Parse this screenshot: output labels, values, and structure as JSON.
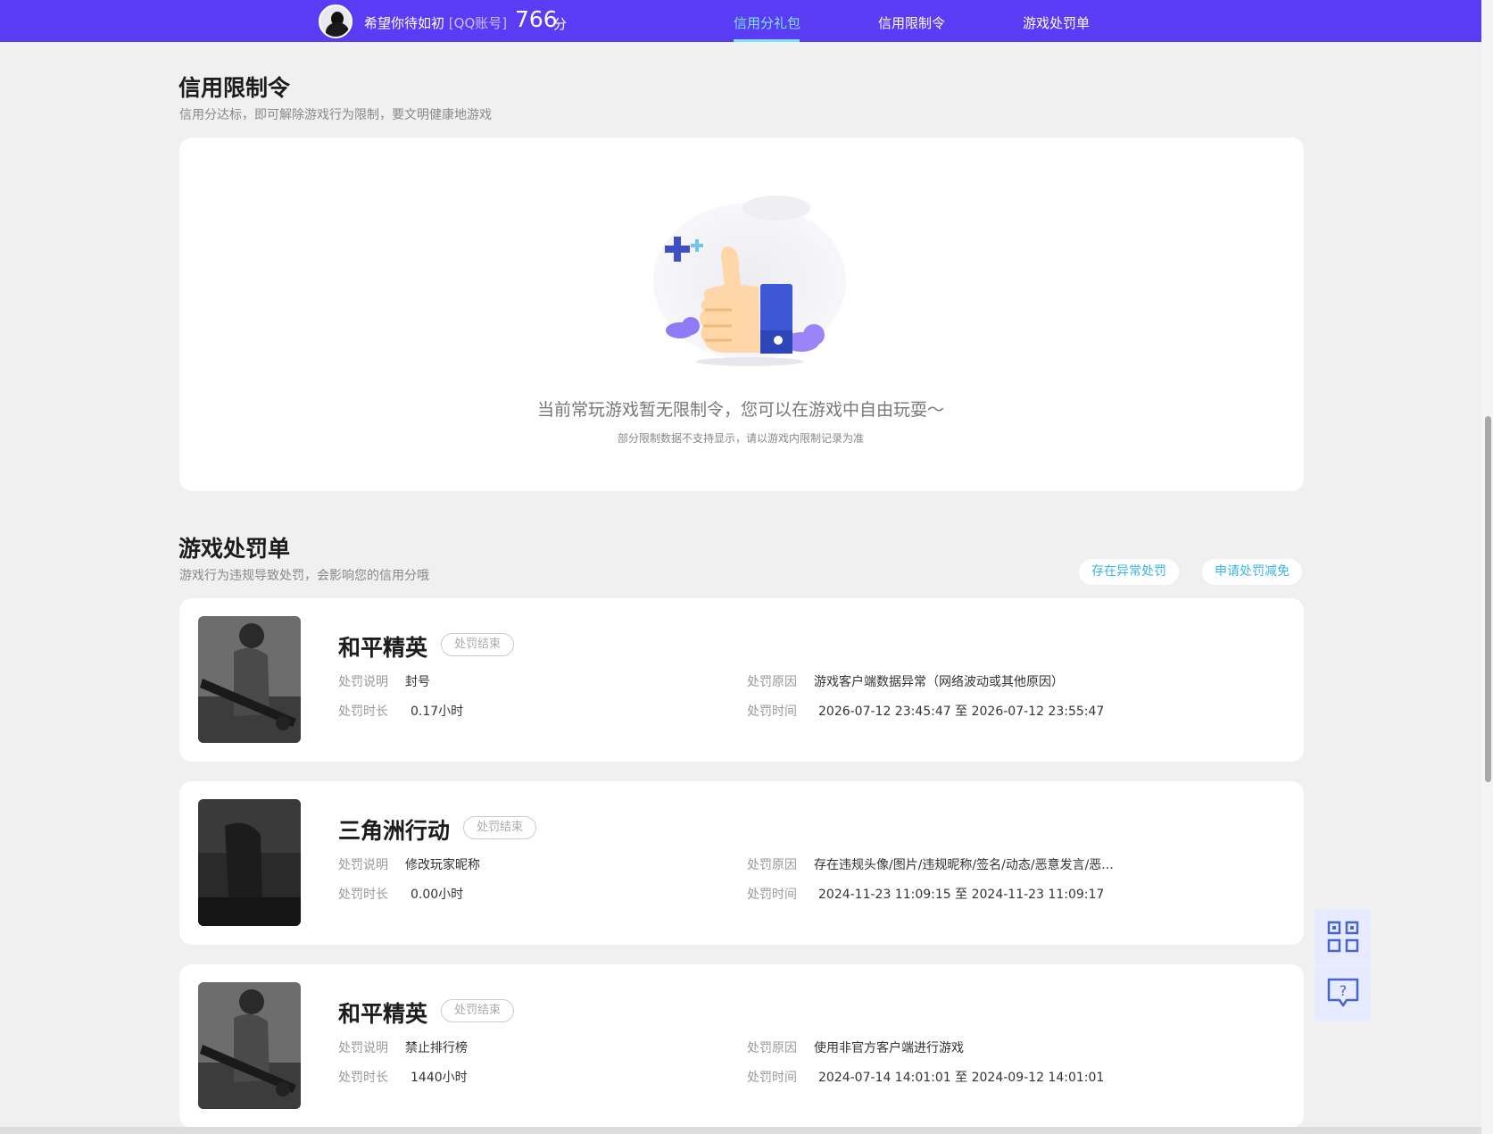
{
  "header": {
    "user_name": "希望你待如初",
    "account_type": "[QQ账号]",
    "score": "766",
    "score_unit": "分",
    "nav": [
      {
        "label": "信用分礼包",
        "active": true
      },
      {
        "label": "信用限制令",
        "active": false
      },
      {
        "label": "游戏处罚单",
        "active": false
      }
    ]
  },
  "restriction": {
    "title": "信用限制令",
    "subtitle": "信用分达标，即可解除游戏行为限制，要文明健康地游戏",
    "empty_main": "当前常玩游戏暂无限制令，您可以在游戏中自由玩耍～",
    "empty_sub": "部分限制数据不支持显示，请以游戏内限制记录为准"
  },
  "punishment": {
    "title": "游戏处罚单",
    "subtitle": "游戏行为违规导致处罚，会影响您的信用分哦",
    "btn_abnormal": "存在异常处罚",
    "btn_reduce": "申请处罚减免",
    "labels": {
      "desc": "处罚说明",
      "duration": "处罚时长",
      "reason": "处罚原因",
      "time": "处罚时间",
      "to": "至"
    },
    "items": [
      {
        "game": "和平精英",
        "status": "处罚结束",
        "desc": "封号",
        "duration": "0.17小时",
        "reason": "游戏客户端数据异常（网络波动或其他原因）",
        "start": "2026-07-12 23:45:47",
        "end": "2026-07-12 23:55:47"
      },
      {
        "game": "三角洲行动",
        "status": "处罚结束",
        "desc": "修改玩家昵称",
        "duration": "0.00小时",
        "reason": "存在违规头像/图片/违规昵称/签名/动态/恶意发言/恶...",
        "start": "2024-11-23 11:09:15",
        "end": "2024-11-23 11:09:17"
      },
      {
        "game": "和平精英",
        "status": "处罚结束",
        "desc": "禁止排行榜",
        "duration": "1440小时",
        "reason": "使用非官方客户端进行游戏",
        "start": "2024-07-14 14:01:01",
        "end": "2024-09-12 14:01:01"
      }
    ]
  },
  "floating_tools": [
    "qrcode-icon",
    "feedback-icon"
  ],
  "colors": {
    "header_bg": "#5a3cf5",
    "nav_active": "#7fe3ff",
    "accent_link": "#3ab5e6",
    "page_bg": "#f0f0f0"
  }
}
